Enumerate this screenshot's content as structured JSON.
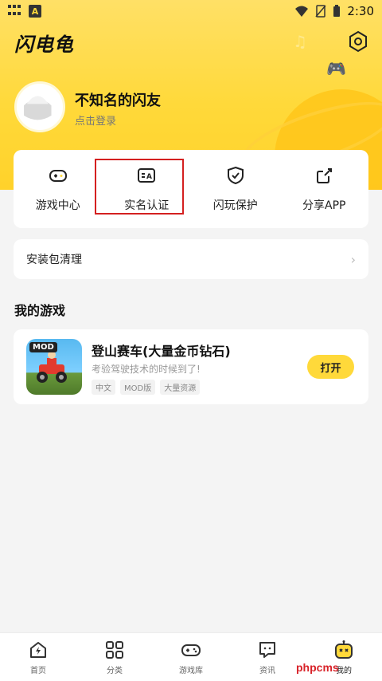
{
  "status_bar": {
    "time": "2:30"
  },
  "header": {
    "app_title": "闪电龟"
  },
  "profile": {
    "username": "不知名的闪友",
    "login_hint": "点击登录"
  },
  "quick_actions": [
    {
      "label": "游戏中心",
      "icon": "gamepad-icon"
    },
    {
      "label": "实名认证",
      "icon": "id-card-icon"
    },
    {
      "label": "闪玩保护",
      "icon": "shield-check-icon"
    },
    {
      "label": "分享APP",
      "icon": "share-icon"
    }
  ],
  "clean_card": {
    "label": "安装包清理"
  },
  "my_games": {
    "section_title": "我的游戏",
    "games": [
      {
        "icon_badge": "MOD",
        "name": "登山赛车(大量金币钻石)",
        "desc": "考验驾驶技术的时候到了!",
        "tags": [
          "中文",
          "MOD版",
          "大量资源"
        ],
        "action": "打开"
      }
    ]
  },
  "bottom_nav": [
    {
      "label": "首页",
      "icon": "home-lightning-icon"
    },
    {
      "label": "分类",
      "icon": "category-grid-icon"
    },
    {
      "label": "游戏库",
      "icon": "gamepad-icon"
    },
    {
      "label": "资讯",
      "icon": "news-chat-icon"
    },
    {
      "label": "我的",
      "icon": "robot-mascot-icon",
      "active": true
    }
  ],
  "watermark": "phpcms",
  "colors": {
    "accent": "#ffd93a",
    "highlight": "#d42020"
  }
}
